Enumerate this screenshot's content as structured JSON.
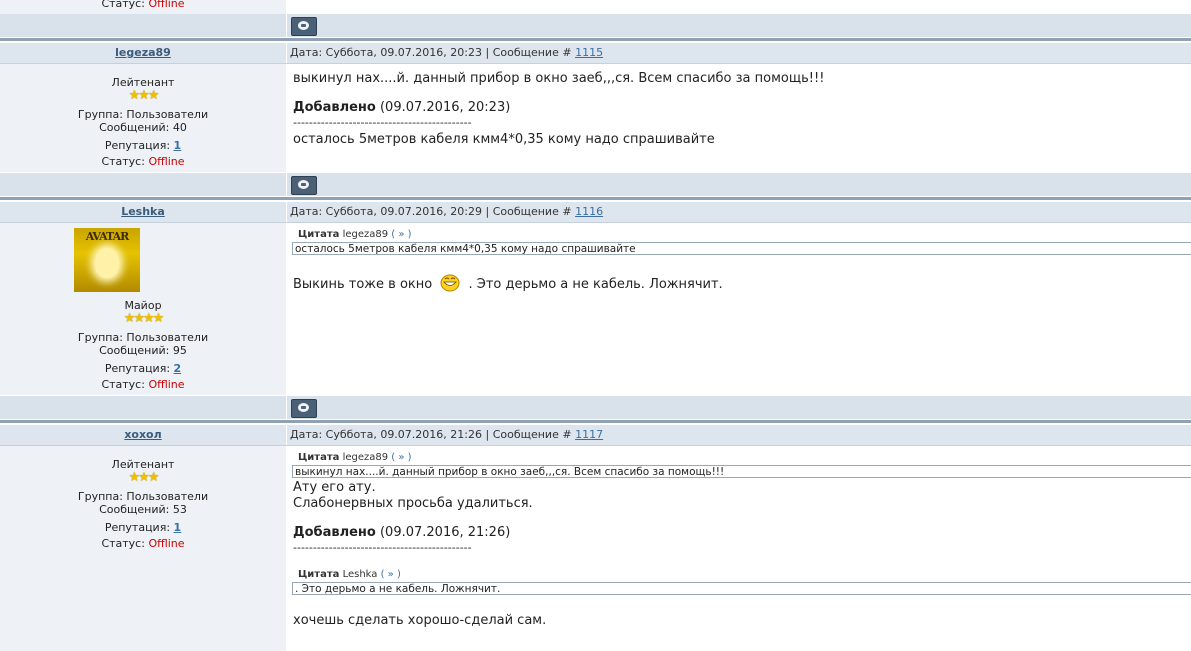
{
  "prev_post": {
    "status_label": "Статус:",
    "status_value": "Offline"
  },
  "pm_icon_name": "private-message-icon",
  "posts": [
    {
      "nick": "legeza89",
      "date_prefix": "Дата: Суббота, 09.07.2016, 20:23 | Сообщение #",
      "post_number": "1115",
      "rank": "Лейтенант",
      "stars": "★★★",
      "group": "Группа: Пользователи",
      "messages": "Сообщений: 40",
      "rep_label": "Репутация:",
      "rep_value": "1",
      "status_label": "Статус:",
      "status_value": "Offline",
      "body_line1": "выкинул нах....й. данный прибор в окно заеб,,,ся. Всем спасибо за помощь!!!",
      "added_label": "Добавлено",
      "added_time": "(09.07.2016, 20:23)",
      "dashes": "---------------------------------------------",
      "body_line2": "осталось 5метров кабеля кмм4*0,35 кому надо спрашивайте"
    },
    {
      "nick": "Leshka",
      "date_prefix": "Дата: Суббота, 09.07.2016, 20:29 | Сообщение #",
      "post_number": "1116",
      "avatar_text": "AVATAR",
      "rank": "Майор",
      "stars": "★★★★",
      "group": "Группа: Пользователи",
      "messages": "Сообщений: 95",
      "rep_label": "Репутация:",
      "rep_value": "2",
      "status_label": "Статус:",
      "status_value": "Offline",
      "quote_label": "Цитата",
      "quote_author": "legeza89",
      "quote_link": "( » )",
      "quote_text": "осталось 5метров кабеля кмм4*0,35 кому надо спрашивайте",
      "body_before_smile": "Выкинь тоже в окно",
      "body_after_smile": ". Это дерьмо а не кабель. Ложнячит."
    },
    {
      "nick": "хохол",
      "date_prefix": "Дата: Суббота, 09.07.2016, 21:26 | Сообщение #",
      "post_number": "1117",
      "rank": "Лейтенант",
      "stars": "★★★",
      "group": "Группа: Пользователи",
      "messages": "Сообщений: 53",
      "rep_label": "Репутация:",
      "rep_value": "1",
      "status_label": "Статус:",
      "status_value": "Offline",
      "quote1_label": "Цитата",
      "quote1_author": "legeza89",
      "quote1_link": "( » )",
      "quote1_text": "выкинул нах....й. данный прибор в окно заеб,,,ся. Всем спасибо за помощь!!!",
      "body_line1": "Ату его ату.",
      "body_line2": "Слабонервных просьба удалиться.",
      "added_label": "Добавлено",
      "added_time": "(09.07.2016, 21:26)",
      "dashes": "---------------------------------------------",
      "quote2_label": "Цитата",
      "quote2_author": "Leshka",
      "quote2_link": "( » )",
      "quote2_text": ". Это дерьмо а не кабель. Ложнячит.",
      "body_line3": "хочешь сделать хорошо-сделай сам."
    }
  ]
}
